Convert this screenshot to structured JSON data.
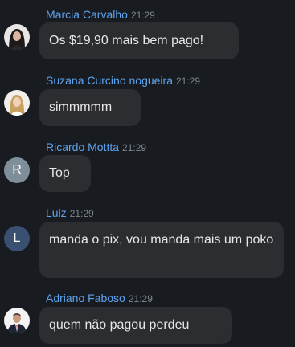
{
  "messages": [
    {
      "author": "Marcia Carvalho",
      "time": "21:29",
      "text": "Os $19,90 mais bem pago!",
      "avatar": {
        "kind": "photo",
        "icon": "woman-dark-hair-photo"
      }
    },
    {
      "author": "Suzana Curcino nogueira",
      "time": "21:29",
      "text": "simmmmm",
      "avatar": {
        "kind": "photo",
        "icon": "woman-blonde-photo"
      }
    },
    {
      "author": "Ricardo Mottta",
      "time": "21:29",
      "text": "Top",
      "avatar": {
        "kind": "letter",
        "letter": "R",
        "color": "#7e8f9a"
      }
    },
    {
      "author": "Luiz",
      "time": "21:29",
      "text": "manda o pix, vou manda mais um poko",
      "avatar": {
        "kind": "letter",
        "letter": "L",
        "color": "#3a5070"
      }
    },
    {
      "author": "Adriano Faboso",
      "time": "21:29",
      "text": "quem não pagou perdeu",
      "avatar": {
        "kind": "photo",
        "icon": "man-suit-photo"
      }
    }
  ],
  "colors": {
    "background": "#181b20",
    "bubble": "#2b2d31",
    "author_name": "#5ea3ee",
    "timestamp": "#7f858d"
  }
}
